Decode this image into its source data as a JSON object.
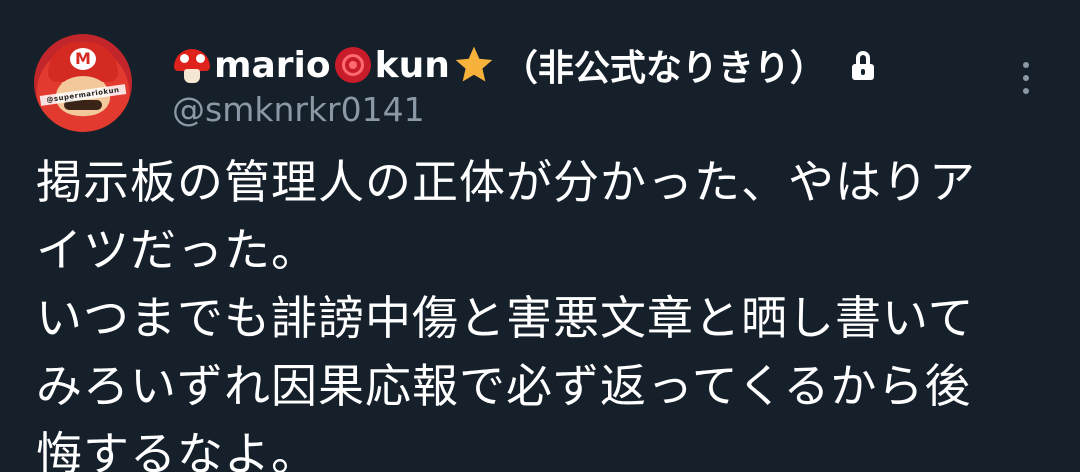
{
  "tweet": {
    "author": {
      "name_part1": "mario",
      "name_part2": "kun",
      "name_suffix": "（非公式なりきり）",
      "handle": "@smknrkr0141",
      "avatar_text": "@supermariokun",
      "avatar_badge": "M",
      "icons": [
        "mushroom-icon",
        "rose-icon",
        "star-icon",
        "lock-icon"
      ]
    },
    "body_text": "掲示板の管理人の正体が分かった、やはりア\nイツだった。\nいつまでも誹謗中傷と害悪文章と晒し書いて\nみろいずれ因果応報で必ず返ってくるから後\n悔するなよ。"
  },
  "colors": {
    "background": "#15202b",
    "text": "#ffffff",
    "secondary_text": "#8b98a5"
  }
}
